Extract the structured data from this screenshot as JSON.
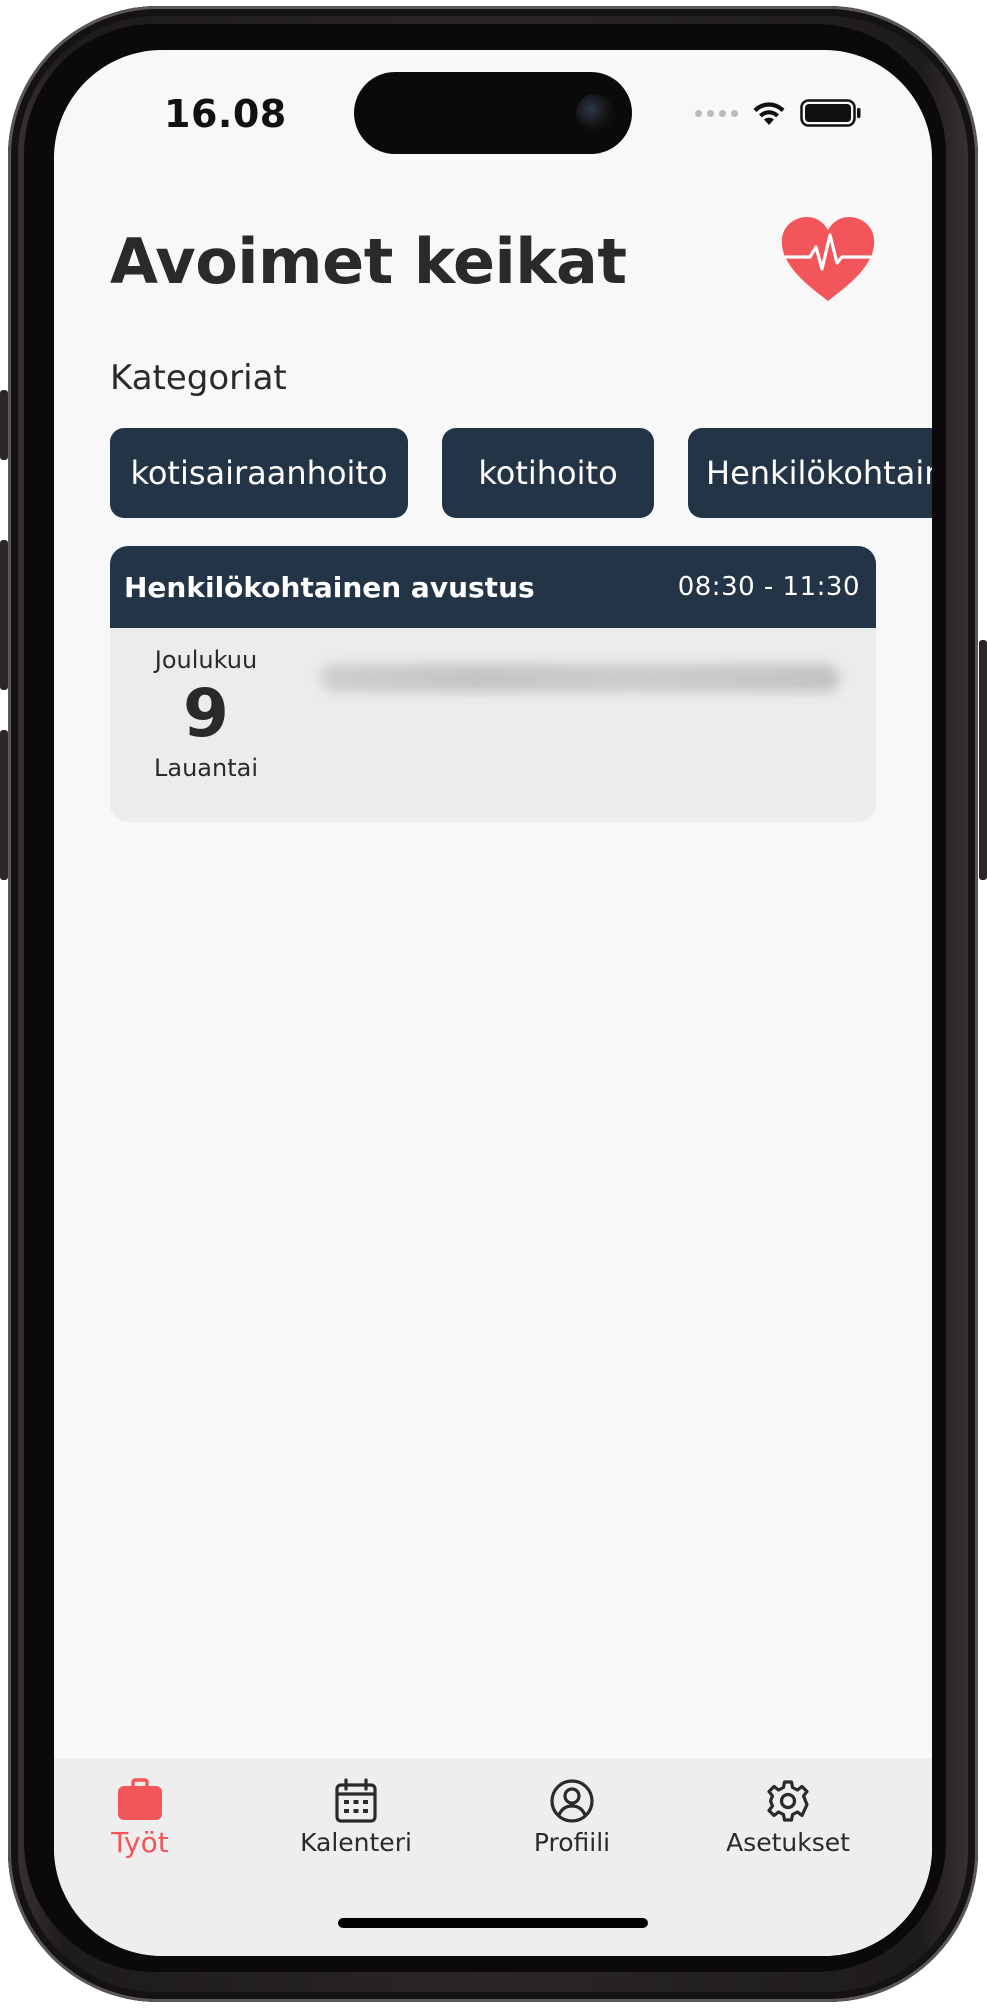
{
  "status_bar": {
    "time": "16.08"
  },
  "header": {
    "title": "Avoimet keikat",
    "logo_icon": "heart-pulse-icon",
    "logo_color": "#f2555a"
  },
  "categories": {
    "heading": "Kategoriat",
    "chips": [
      "kotisairaanhoito",
      "kotihoito",
      "Henkilökohtainen avustus"
    ]
  },
  "jobs": [
    {
      "title": "Henkilökohtainen avustus",
      "time": "08:30 - 11:30",
      "month": "Joulukuu",
      "day": "9",
      "weekday": "Lauantai"
    }
  ],
  "nav": {
    "items": [
      {
        "label": "Työt",
        "icon": "briefcase-icon",
        "active": true
      },
      {
        "label": "Kalenteri",
        "icon": "calendar-icon",
        "active": false
      },
      {
        "label": "Profiili",
        "icon": "user-circle-icon",
        "active": false
      },
      {
        "label": "Asetukset",
        "icon": "gear-icon",
        "active": false
      }
    ]
  },
  "colors": {
    "accent": "#f2555a",
    "navy": "#243447",
    "background": "#f8f8f8",
    "card": "#ececec"
  }
}
